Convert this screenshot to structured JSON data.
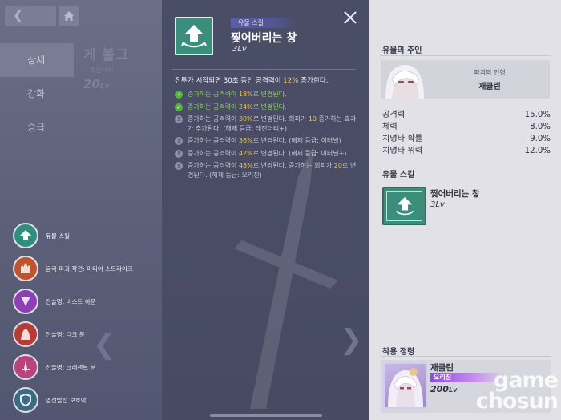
{
  "background": {
    "menu": [
      "상세",
      "강화",
      "승급"
    ],
    "artifact_title": "게 볼그",
    "artifact_grade": "레전더리",
    "artifact_level": "20",
    "artifact_level_unit": "Lv",
    "skill_list": [
      {
        "label": "유물 스킬",
        "icon": "up-arrow-icon",
        "color": "#2f8f7d"
      },
      {
        "label": "궁극 파괴 작전: 미티어 스트라이크",
        "icon": "castle-icon",
        "color": "#c0522d"
      },
      {
        "label": "전술명: 버스트 하운",
        "icon": "burst-icon",
        "color": "#8d3fb6"
      },
      {
        "label": "전술명: 다크 문",
        "icon": "hood-icon",
        "color": "#b43b36"
      },
      {
        "label": "전술명: 크레센트 문",
        "icon": "blade-icon",
        "color": "#b8447e"
      },
      {
        "label": "열전발전 보호막",
        "icon": "shield-icon",
        "color": "#3c6a80"
      }
    ]
  },
  "detail": {
    "tag": "유물 스킬",
    "name": "찢어버리는 창",
    "level": "3Lv",
    "description_prefix": "전투가 시작되면 30초 동안 공격력이 ",
    "description_value": "12%",
    "description_suffix": " 증가한다.",
    "effects": [
      {
        "status": "active",
        "prefix": "증가하는 공격력이 ",
        "value": "18%",
        "suffix": "로 변경된다.",
        "extra": ""
      },
      {
        "status": "active",
        "prefix": "증가하는 공격력이 ",
        "value": "24%",
        "suffix": "로 변경된다.",
        "extra": ""
      },
      {
        "status": "locked",
        "prefix": "증가하는 공격력이 ",
        "value": "30%",
        "suffix": "로 변경된다. 회피가 ",
        "value2": "10",
        "suffix2": " 증가하는 효과가 추가된다. (해제 등급: 레전더리+)"
      },
      {
        "status": "locked",
        "prefix": "증가하는 공격력이 ",
        "value": "36%",
        "suffix": "로 변경된다. (해제 등급: 이터널)"
      },
      {
        "status": "locked",
        "prefix": "증가하는 공격력이 ",
        "value": "42%",
        "suffix": "로 변경된다. (해제 등급: 이터널+)"
      },
      {
        "status": "locked",
        "prefix": "증가하는 공격력이 ",
        "value": "48%",
        "suffix": "로 변경된다. 증가하는 회피가 ",
        "value2": "20",
        "suffix2": "로 변경된다. (해제 등급: 오리진)"
      }
    ]
  },
  "owner": {
    "section_title": "유물의 주인",
    "label": "파괴의 인형",
    "name": "재클린"
  },
  "stats": [
    {
      "label": "공격력",
      "value": "15.0%"
    },
    {
      "label": "체력",
      "value": "8.0%"
    },
    {
      "label": "치명타 확률",
      "value": "9.0%"
    },
    {
      "label": "치명타 위력",
      "value": "12.0%"
    }
  ],
  "artifact_skill": {
    "section_title": "유물 스킬",
    "name": "찢어버리는 창",
    "level": "3Lv"
  },
  "equipped": {
    "section_title": "착용 정령",
    "name": "재클린",
    "grade": "오리진",
    "level": "200",
    "level_unit": "Lv"
  },
  "watermark": {
    "line1": "game",
    "line2": "chosun"
  },
  "colors": {
    "skill_green": "#3a8e7c",
    "highlight_gold": "#e6c25a",
    "active_green": "#8fd16a",
    "origin_purple": "#8a4fd6"
  }
}
